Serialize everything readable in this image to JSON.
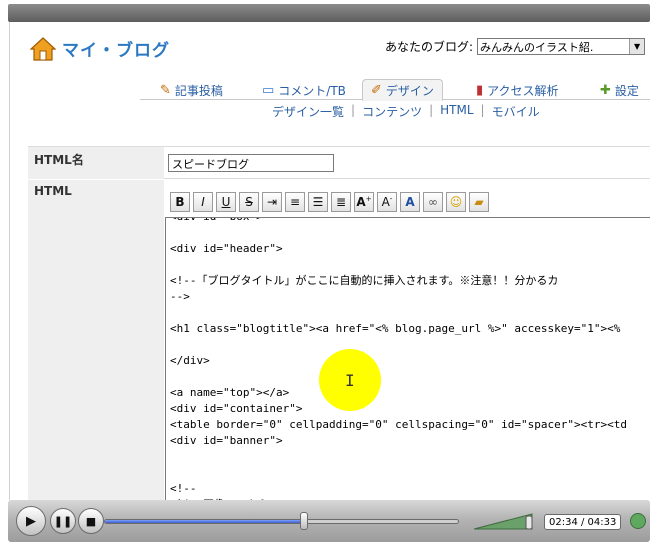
{
  "app": {
    "logo_text": "マイ・ブログ",
    "blog_select_label": "あなたのブログ:",
    "blog_select_value": "みんみんのイラスト紹."
  },
  "tabs": [
    {
      "label": "記事投稿",
      "icon": "pencil-icon"
    },
    {
      "label": "コメント/TB",
      "icon": "speech-bubble-icon"
    },
    {
      "label": "デザイン",
      "icon": "palette-icon",
      "active": true
    },
    {
      "label": "アクセス解析",
      "icon": "bar-chart-icon"
    },
    {
      "label": "設定",
      "icon": "puzzle-icon"
    }
  ],
  "subnav": [
    "デザイン一覧",
    "コンテンツ",
    "HTML",
    "モバイル"
  ],
  "form": {
    "html_name_label": "HTML名",
    "html_name_value": "スピードブログ",
    "html_label": "HTML"
  },
  "toolbar": [
    "B",
    "I",
    "U",
    "S",
    "indent",
    "align-left",
    "align-center",
    "align-right",
    "A+",
    "A-",
    "A-color",
    "link",
    "smiley",
    "folder"
  ],
  "editor_lines": [
    "<div id=\"box\">",
    "",
    "<div id=\"header\">",
    "",
    "<!--「ブログタイトル」がここに自動的に挿入されます。※注意！！分かるカ",
    "-->",
    "",
    "<h1 class=\"blogtitle\"><a href=\"<% blog.page_url %>\" accesskey=\"1\"><%",
    "",
    "</div>",
    "",
    "<a name=\"top\"></a>",
    "<div id=\"container\">",
    "<table border=\"0\" cellpadding=\"0\" cellspacing=\"0\" id=\"spacer\"><tr><td",
    "<div id=\"banner\">",
    "",
    "",
    "<!--",
    "バナー画像ここから"
  ],
  "player": {
    "time": "02:34 / 04:33",
    "progress": 0.564,
    "volume": 0.85
  }
}
